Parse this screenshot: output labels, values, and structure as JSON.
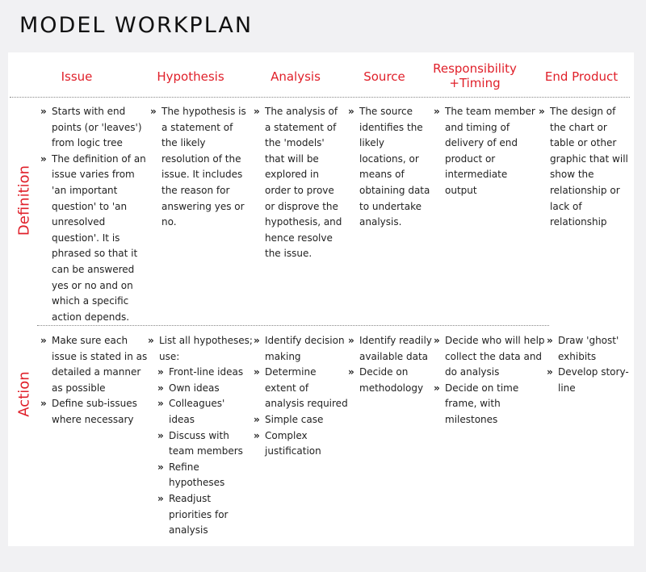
{
  "title": "MODEL WORKPLAN",
  "colors": {
    "accent": "#e0202a",
    "text": "#222222",
    "background": "#f1f1f3",
    "sheet": "#ffffff"
  },
  "columns": [
    "Issue",
    "Hypothesis",
    "Analysis",
    "Source",
    "Responsibility +Timing",
    "End Product"
  ],
  "rows": [
    {
      "label": "Definition",
      "cells": [
        [
          {
            "text": "Starts with end points (or 'leaves') from logic tree",
            "level": 0
          },
          {
            "text": "The definition of an issue varies from 'an important question' to 'an unresolved question'. It is phrased so that it can be answered yes or no and on which a specific action depends.",
            "level": 0
          }
        ],
        [
          {
            "text": "The hypothesis is a statement of the likely resolution of the issue. It includes the reason for answering yes or no.",
            "level": 0
          }
        ],
        [
          {
            "text": "The analysis of a statement of the 'models' that will be explored in order to prove or disprove the hypothesis, and hence resolve the issue.",
            "level": 0
          }
        ],
        [
          {
            "text": "The source identifies the likely locations, or means of obtaining data to undertake analysis.",
            "level": 0
          }
        ],
        [
          {
            "text": "The team member and timing of delivery of end product or intermediate output",
            "level": 0
          }
        ],
        [
          {
            "text": "The design of the chart or table or other graphic that will show the relationship or lack of relationship",
            "level": 0
          }
        ]
      ]
    },
    {
      "label": "Action",
      "cells": [
        [
          {
            "text": "Make sure each issue is stated in as detailed a manner as possible",
            "level": 0
          },
          {
            "text": "Define sub-issues where necessary",
            "level": 0
          }
        ],
        [
          {
            "text": "List all hypotheses; use:",
            "level": 0
          },
          {
            "text": "Front-line ideas",
            "level": 1
          },
          {
            "text": "Own ideas",
            "level": 1
          },
          {
            "text": "Colleagues' ideas",
            "level": 1
          },
          {
            "text": "Discuss with team members",
            "level": 1
          },
          {
            "text": "Refine hypotheses",
            "level": 1
          },
          {
            "text": "Readjust priorities for analysis",
            "level": 1
          }
        ],
        [
          {
            "text": "Identify decision making",
            "level": 0
          },
          {
            "text": "Determine extent of analysis required",
            "level": 0
          },
          {
            "text": "Simple case",
            "level": 0
          },
          {
            "text": "Complex justification",
            "level": 0
          }
        ],
        [
          {
            "text": "Identify readily available data",
            "level": 0
          },
          {
            "text": "Decide on methodology",
            "level": 0
          }
        ],
        [
          {
            "text": "Decide who will help collect the data and do analysis",
            "level": 0
          },
          {
            "text": "Decide on time frame, with milestones",
            "level": 0
          }
        ],
        [
          {
            "text": "Draw 'ghost' exhibits",
            "level": 0
          },
          {
            "text": "Develop story-line",
            "level": 0
          }
        ]
      ]
    }
  ]
}
